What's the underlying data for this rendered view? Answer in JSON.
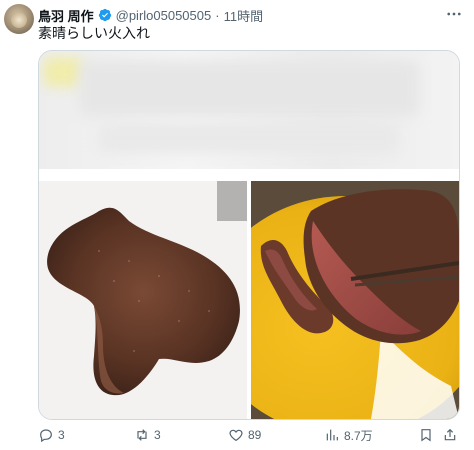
{
  "user": {
    "display_name": "鳥羽 周作",
    "handle": "@pirlo05050505",
    "separator": "·",
    "time": "11時間"
  },
  "tweet": {
    "text": "素晴らしい火入れ"
  },
  "media": {
    "images": [
      {
        "label": "blurred-image"
      },
      {
        "label": "steak-on-cutting-board"
      },
      {
        "label": "sliced-steak-on-yellow-plate"
      }
    ]
  },
  "actions": {
    "reply_count": "3",
    "retweet_count": "3",
    "like_count": "89",
    "view_count": "8.7万"
  },
  "colors": {
    "verified": "#1d9bf0",
    "icon_gray": "#536471",
    "text": "#0f1419",
    "border": "#cfd9de"
  }
}
